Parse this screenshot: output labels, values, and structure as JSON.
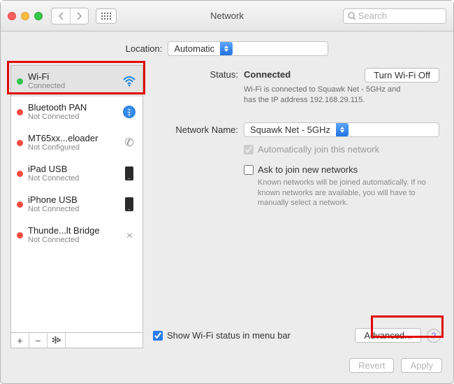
{
  "window": {
    "title": "Network"
  },
  "search": {
    "placeholder": "Search"
  },
  "location": {
    "label": "Location:",
    "value": "Automatic"
  },
  "sidebar": {
    "items": [
      {
        "name": "Wi-Fi",
        "sub": "Connected",
        "status": "green",
        "icon": "wifi"
      },
      {
        "name": "Bluetooth PAN",
        "sub": "Not Connected",
        "status": "red",
        "icon": "bluetooth"
      },
      {
        "name": "MT65xx...eloader",
        "sub": "Not Configured",
        "status": "red",
        "icon": "telephony"
      },
      {
        "name": "iPad USB",
        "sub": "Not Connected",
        "status": "red",
        "icon": "phone"
      },
      {
        "name": "iPhone USB",
        "sub": "Not Connected",
        "status": "red",
        "icon": "phone"
      },
      {
        "name": "Thunde...lt Bridge",
        "sub": "Not Connected",
        "status": "red",
        "icon": "bridge"
      }
    ]
  },
  "detail": {
    "status_label": "Status:",
    "status_value": "Connected",
    "turn_off_label": "Turn Wi-Fi Off",
    "status_desc": "Wi-Fi is connected to Squawk Net - 5GHz and has the IP address 192.168.29.115.",
    "network_name_label": "Network Name:",
    "network_name_value": "Squawk Net - 5GHz",
    "auto_join_label": "Automatically join this network",
    "ask_join_label": "Ask to join new networks",
    "ask_join_desc": "Known networks will be joined automatically. If no known networks are available, you will have to manually select a network.",
    "show_status_label": "Show Wi-Fi status in menu bar",
    "advanced_label": "Advanced..."
  },
  "footer": {
    "revert_label": "Revert",
    "apply_label": "Apply"
  }
}
